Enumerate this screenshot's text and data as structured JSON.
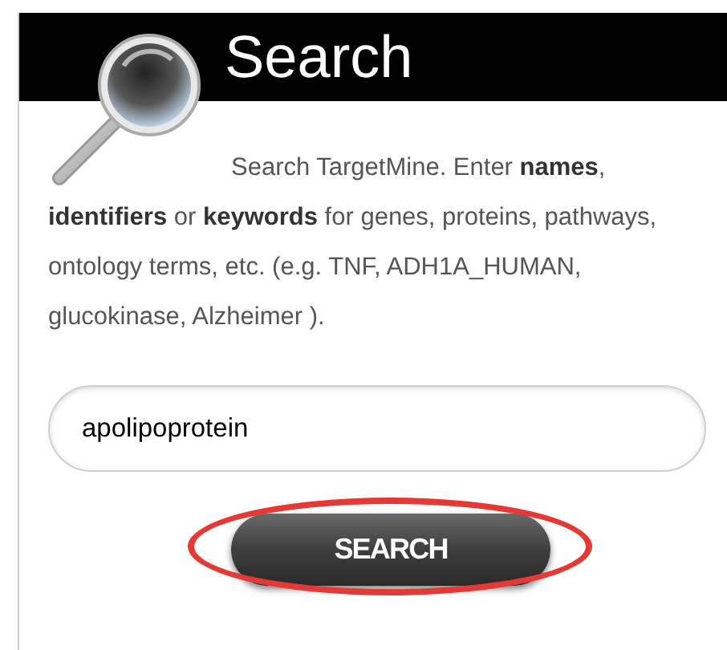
{
  "header": {
    "title": "Search"
  },
  "description": "Search TargetMine. Enter **names**, **identifiers** or **keywords** for genes, proteins, pathways, ontology terms, etc. (e.g. TNF, ADH1A_HUMAN, glucokinase, Alzheimer ).",
  "search_field": {
    "value": "apolipoprotein"
  },
  "search_button": {
    "label": "SEARCH",
    "highlighted": true
  }
}
